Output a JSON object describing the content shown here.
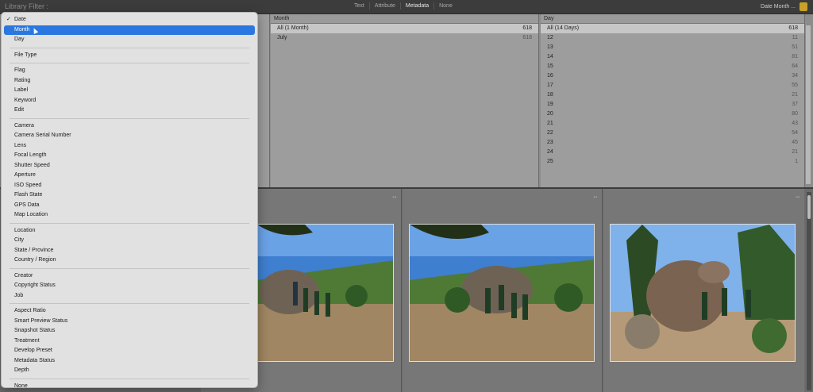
{
  "filter_bar": {
    "label": "Library Filter :",
    "tabs": [
      "Text",
      "Attribute",
      "Metadata",
      "None"
    ],
    "active_tab": "Metadata",
    "preset": "Date Month ..."
  },
  "columns": {
    "month": {
      "header": "Month",
      "rows": [
        {
          "label": "All (1 Month)",
          "count": "618",
          "selected": true
        },
        {
          "label": "July",
          "count": "618",
          "selected": false
        }
      ]
    },
    "day": {
      "header": "Day",
      "rows": [
        {
          "label": "All (14 Days)",
          "count": "618",
          "selected": true
        },
        {
          "label": "12",
          "count": "11"
        },
        {
          "label": "13",
          "count": "51"
        },
        {
          "label": "14",
          "count": "81"
        },
        {
          "label": "15",
          "count": "64"
        },
        {
          "label": "16",
          "count": "34"
        },
        {
          "label": "17",
          "count": "55"
        },
        {
          "label": "18",
          "count": "21"
        },
        {
          "label": "19",
          "count": "37"
        },
        {
          "label": "20",
          "count": "80"
        },
        {
          "label": "21",
          "count": "43"
        },
        {
          "label": "22",
          "count": "54"
        },
        {
          "label": "23",
          "count": "45"
        },
        {
          "label": "24",
          "count": "21"
        },
        {
          "label": "25",
          "count": "1"
        }
      ]
    }
  },
  "menu": {
    "selected": "Month",
    "groups": [
      [
        "Date",
        "Month",
        "Day"
      ],
      [
        "File Type"
      ],
      [
        "Flag",
        "Rating",
        "Label",
        "Keyword",
        "Edit"
      ],
      [
        "Camera",
        "Camera Serial Number",
        "Lens",
        "Focal Length",
        "Shutter Speed",
        "Aperture",
        "ISO Speed",
        "Flash State",
        "GPS Data",
        "Map Location"
      ],
      [
        "Location",
        "City",
        "State / Province",
        "Country / Region"
      ],
      [
        "Creator",
        "Copyright Status",
        "Job"
      ],
      [
        "Aspect Ratio",
        "Smart Preview Status",
        "Snapshot Status",
        "Treatment",
        "Develop Preset",
        "Metadata Status",
        "Depth"
      ],
      [
        "None"
      ]
    ],
    "checked": "Date"
  },
  "colors": {
    "menu_highlight": "#2a77e0",
    "lock_icon": "#c9a227"
  }
}
